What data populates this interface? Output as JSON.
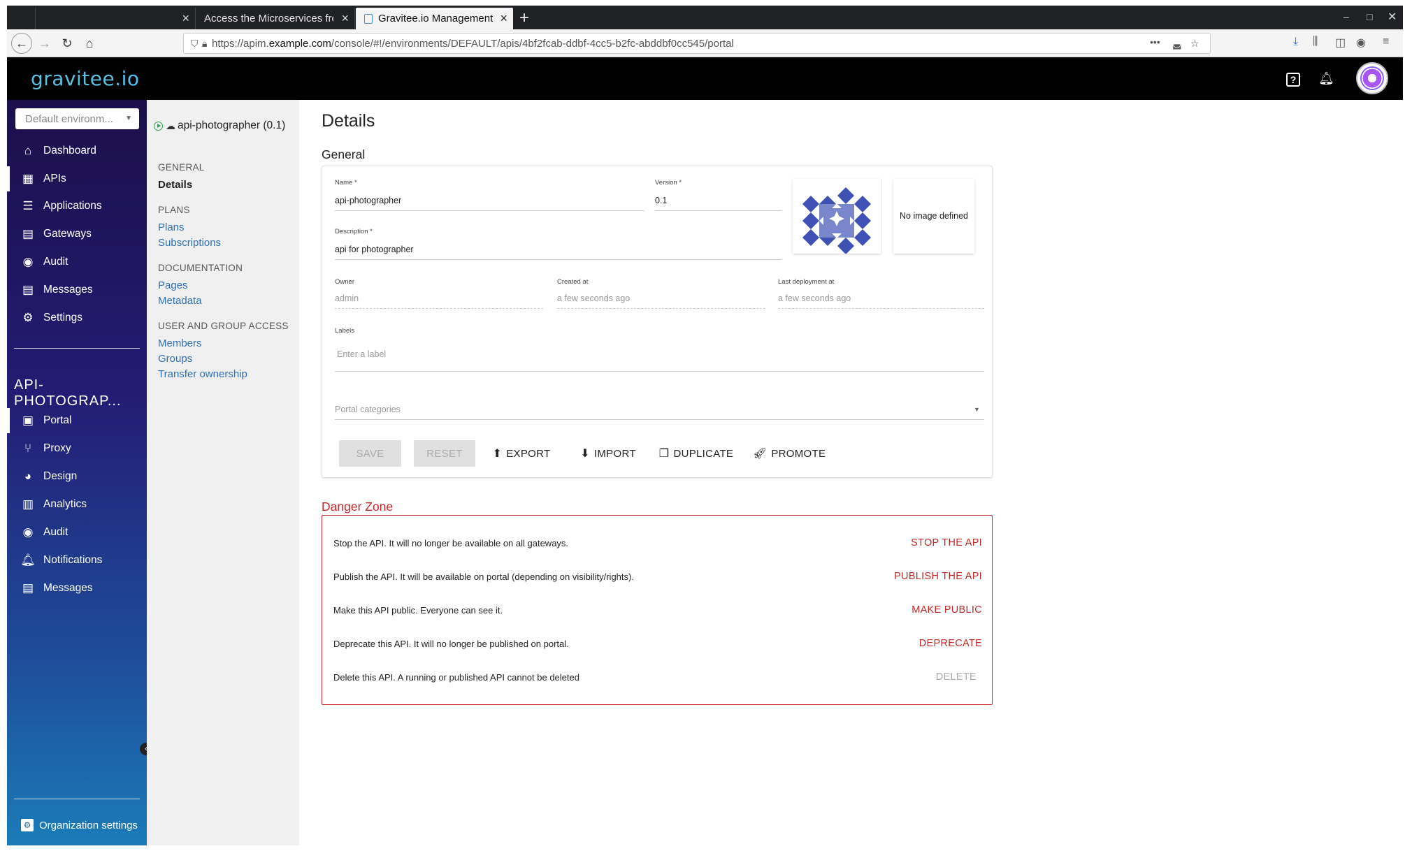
{
  "browser": {
    "tabs": [
      {
        "title": ""
      },
      {
        "title": "Access the Microservices fro"
      },
      {
        "title": "Gravitee.io Management"
      }
    ],
    "url_prefix": "https://apim.",
    "url_domain": "example.com",
    "url_path": "/console/#!/environments/DEFAULT/apis/4bf2fcab-ddbf-4cc5-b2fc-abddbf0cc545/portal"
  },
  "header": {
    "logo": "gravitee",
    "logo_dot": ".io"
  },
  "sidebar": {
    "env_select": "Default environm...",
    "items": [
      {
        "label": "Dashboard",
        "icon": "home-icon"
      },
      {
        "label": "APIs",
        "icon": "apis-icon"
      },
      {
        "label": "Applications",
        "icon": "list-icon"
      },
      {
        "label": "Gateways",
        "icon": "gateway-icon"
      },
      {
        "label": "Audit",
        "icon": "eye-icon"
      },
      {
        "label": "Messages",
        "icon": "message-icon"
      },
      {
        "label": "Settings",
        "icon": "gear-icon"
      }
    ],
    "api_title": "API-PHOTOGRAP...",
    "api_items": [
      {
        "label": "Portal",
        "icon": "portal-icon"
      },
      {
        "label": "Proxy",
        "icon": "proxy-icon"
      },
      {
        "label": "Design",
        "icon": "palette-icon"
      },
      {
        "label": "Analytics",
        "icon": "analytics-icon"
      },
      {
        "label": "Audit",
        "icon": "eye-icon"
      },
      {
        "label": "Notifications",
        "icon": "bell-icon"
      },
      {
        "label": "Messages",
        "icon": "message-icon"
      }
    ],
    "org_settings": "Organization settings"
  },
  "submenu": {
    "api_name": "api-photographer (0.1)",
    "general_head": "GENERAL",
    "details": "Details",
    "plans_head": "PLANS",
    "plans": "Plans",
    "subscriptions": "Subscriptions",
    "doc_head": "DOCUMENTATION",
    "pages": "Pages",
    "metadata": "Metadata",
    "access_head": "USER AND GROUP ACCESS",
    "members": "Members",
    "groups": "Groups",
    "transfer": "Transfer ownership"
  },
  "main": {
    "title": "Details",
    "general": "General",
    "name_label": "Name *",
    "name_value": "api-photographer",
    "version_label": "Version *",
    "version_value": "0.1",
    "desc_label": "Description *",
    "desc_value": "api for photographer",
    "no_image": "No image defined",
    "owner_label": "Owner",
    "owner_value": "admin",
    "created_label": "Created at",
    "created_value": "a few seconds ago",
    "deploy_label": "Last deployment at",
    "deploy_value": "a few seconds ago",
    "labels_label": "Labels",
    "labels_placeholder": "Enter a label",
    "categories_placeholder": "Portal categories",
    "buttons": {
      "save": "SAVE",
      "reset": "RESET",
      "export": "EXPORT",
      "import": "IMPORT",
      "duplicate": "DUPLICATE",
      "promote": "PROMOTE"
    }
  },
  "danger": {
    "title": "Danger Zone",
    "rows": [
      {
        "text": "Stop the API. It will no longer be available on all gateways.",
        "action": "STOP THE API"
      },
      {
        "text": "Publish the API. It will be available on portal (depending on visibility/rights).",
        "action": "PUBLISH THE API"
      },
      {
        "text": "Make this API public. Everyone can see it.",
        "action": "MAKE PUBLIC"
      },
      {
        "text": "Deprecate this API. It will no longer be published on portal.",
        "action": "DEPRECATE"
      },
      {
        "text": "Delete this API. A running or published API cannot be deleted",
        "action": "DELETE"
      }
    ]
  },
  "colors": {
    "accent_link": "#2f6fb3",
    "danger": "#c62828",
    "sidebar_top": "#1c0f4a",
    "sidebar_bottom": "#1b7bb8"
  }
}
